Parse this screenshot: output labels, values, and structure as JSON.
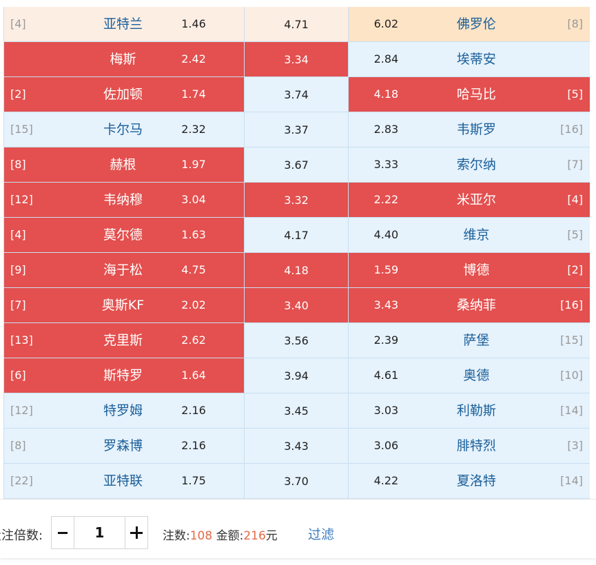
{
  "matches": [
    {
      "home_rank": "[4]",
      "home": "亚特兰",
      "home_odd": "1.46",
      "draw_odd": "4.71",
      "away_odd": "6.02",
      "away": "佛罗伦",
      "away_rank": "[8]",
      "home_state": "peach",
      "draw_state": "peach",
      "away_state": "tan"
    },
    {
      "home_rank": "",
      "home": "梅斯",
      "home_odd": "2.42",
      "draw_odd": "3.34",
      "away_odd": "2.84",
      "away": "埃蒂安",
      "away_rank": "",
      "home_state": "sel",
      "draw_state": "sel",
      "away_state": "normal"
    },
    {
      "home_rank": "[2]",
      "home": "佐加顿",
      "home_odd": "1.74",
      "draw_odd": "3.74",
      "away_odd": "4.18",
      "away": "哈马比",
      "away_rank": "[5]",
      "home_state": "sel",
      "draw_state": "normal",
      "away_state": "sel"
    },
    {
      "home_rank": "[15]",
      "home": "卡尔马",
      "home_odd": "2.32",
      "draw_odd": "3.37",
      "away_odd": "2.83",
      "away": "韦斯罗",
      "away_rank": "[16]",
      "home_state": "normal",
      "draw_state": "normal",
      "away_state": "normal"
    },
    {
      "home_rank": "[8]",
      "home": "赫根",
      "home_odd": "1.97",
      "draw_odd": "3.67",
      "away_odd": "3.33",
      "away": "索尔纳",
      "away_rank": "[7]",
      "home_state": "sel",
      "draw_state": "normal",
      "away_state": "normal"
    },
    {
      "home_rank": "[12]",
      "home": "韦纳穆",
      "home_odd": "3.04",
      "draw_odd": "3.32",
      "away_odd": "2.22",
      "away": "米亚尔",
      "away_rank": "[4]",
      "home_state": "sel",
      "draw_state": "sel",
      "away_state": "sel"
    },
    {
      "home_rank": "[4]",
      "home": "莫尔德",
      "home_odd": "1.63",
      "draw_odd": "4.17",
      "away_odd": "4.40",
      "away": "维京",
      "away_rank": "[5]",
      "home_state": "sel",
      "draw_state": "normal",
      "away_state": "normal"
    },
    {
      "home_rank": "[9]",
      "home": "海于松",
      "home_odd": "4.75",
      "draw_odd": "4.18",
      "away_odd": "1.59",
      "away": "博德",
      "away_rank": "[2]",
      "home_state": "sel",
      "draw_state": "sel",
      "away_state": "sel"
    },
    {
      "home_rank": "[7]",
      "home": "奥斯KF",
      "home_odd": "2.02",
      "draw_odd": "3.40",
      "away_odd": "3.43",
      "away": "桑纳菲",
      "away_rank": "[16]",
      "home_state": "sel",
      "draw_state": "sel",
      "away_state": "sel"
    },
    {
      "home_rank": "[13]",
      "home": "克里斯",
      "home_odd": "2.62",
      "draw_odd": "3.56",
      "away_odd": "2.39",
      "away": "萨堡",
      "away_rank": "[15]",
      "home_state": "sel",
      "draw_state": "normal",
      "away_state": "normal"
    },
    {
      "home_rank": "[6]",
      "home": "斯特罗",
      "home_odd": "1.64",
      "draw_odd": "3.94",
      "away_odd": "4.61",
      "away": "奥德",
      "away_rank": "[10]",
      "home_state": "sel",
      "draw_state": "normal",
      "away_state": "normal"
    },
    {
      "home_rank": "[12]",
      "home": "特罗姆",
      "home_odd": "2.16",
      "draw_odd": "3.45",
      "away_odd": "3.03",
      "away": "利勒斯",
      "away_rank": "[14]",
      "home_state": "normal",
      "draw_state": "normal",
      "away_state": "normal"
    },
    {
      "home_rank": "[8]",
      "home": "罗森博",
      "home_odd": "2.16",
      "draw_odd": "3.43",
      "away_odd": "3.06",
      "away": "腓特烈",
      "away_rank": "[3]",
      "home_state": "normal",
      "draw_state": "normal",
      "away_state": "normal"
    },
    {
      "home_rank": "[22]",
      "home": "亚特联",
      "home_odd": "1.75",
      "draw_odd": "3.70",
      "away_odd": "4.22",
      "away": "夏洛特",
      "away_rank": "[14]",
      "home_state": "normal",
      "draw_state": "normal",
      "away_state": "normal"
    }
  ],
  "footer": {
    "multiplier_label": "投注倍数:",
    "multiplier_value": "1",
    "minus_label": "-",
    "plus_label": "+",
    "count_label": "注数:",
    "count_value": "108",
    "amount_label": "金额:",
    "amount_value": "216",
    "amount_unit": "元",
    "filter_label": "过滤"
  },
  "colors": {
    "selected": "#e3504f",
    "normal": "#e6f2fc",
    "highlight_peach": "#fdeee4",
    "highlight_tan": "#fde4c6",
    "team_text": "#1a5f99",
    "accent_number": "#e46a46",
    "link": "#3c7cc0"
  }
}
